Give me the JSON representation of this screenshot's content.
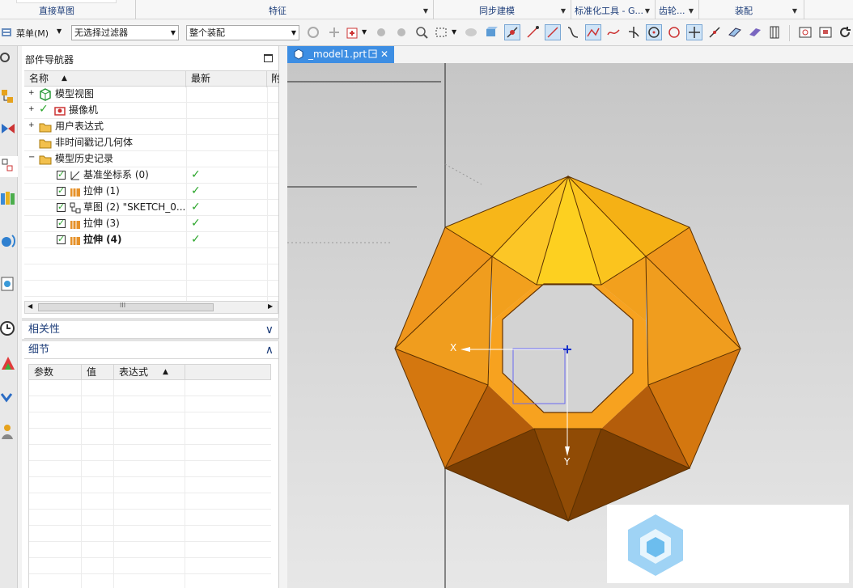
{
  "ribbon": {
    "groups": [
      {
        "label": "直接草图"
      },
      {
        "label": "特征"
      },
      {
        "label": "同步建模"
      },
      {
        "label": "标准化工具 - G..."
      },
      {
        "label": "齿轮..."
      },
      {
        "label": "装配"
      }
    ]
  },
  "toolbar": {
    "menu_label": "菜单(M)",
    "filter_value": "无选择过滤器",
    "scope_value": "整个装配"
  },
  "navigator": {
    "title": "部件导航器",
    "columns": {
      "name": "名称",
      "latest": "最新",
      "extra": "附"
    },
    "nodes": [
      {
        "label": "模型视图"
      },
      {
        "label": "摄像机"
      },
      {
        "label": "用户表达式"
      },
      {
        "label": "非时间戳记几何体"
      },
      {
        "label": "模型历史记录"
      }
    ],
    "features": [
      {
        "label": "基准坐标系 (0)"
      },
      {
        "label": "拉伸 (1)"
      },
      {
        "label": "草图 (2) \"SKETCH_0..."
      },
      {
        "label": "拉伸 (3)"
      },
      {
        "label": "拉伸 (4)"
      }
    ],
    "scroll_mid": "III"
  },
  "dependencies": {
    "title": "相关性"
  },
  "details": {
    "title": "细节",
    "columns": {
      "param": "参数",
      "value": "值",
      "expr": "表达式"
    }
  },
  "document": {
    "tab": "_model1.prt"
  },
  "viewport": {
    "axis_x": "X",
    "axis_y": "Y"
  },
  "colors": {
    "accent": "#3d8ee3",
    "model": "#f5a623",
    "check": "#2aa52a"
  }
}
